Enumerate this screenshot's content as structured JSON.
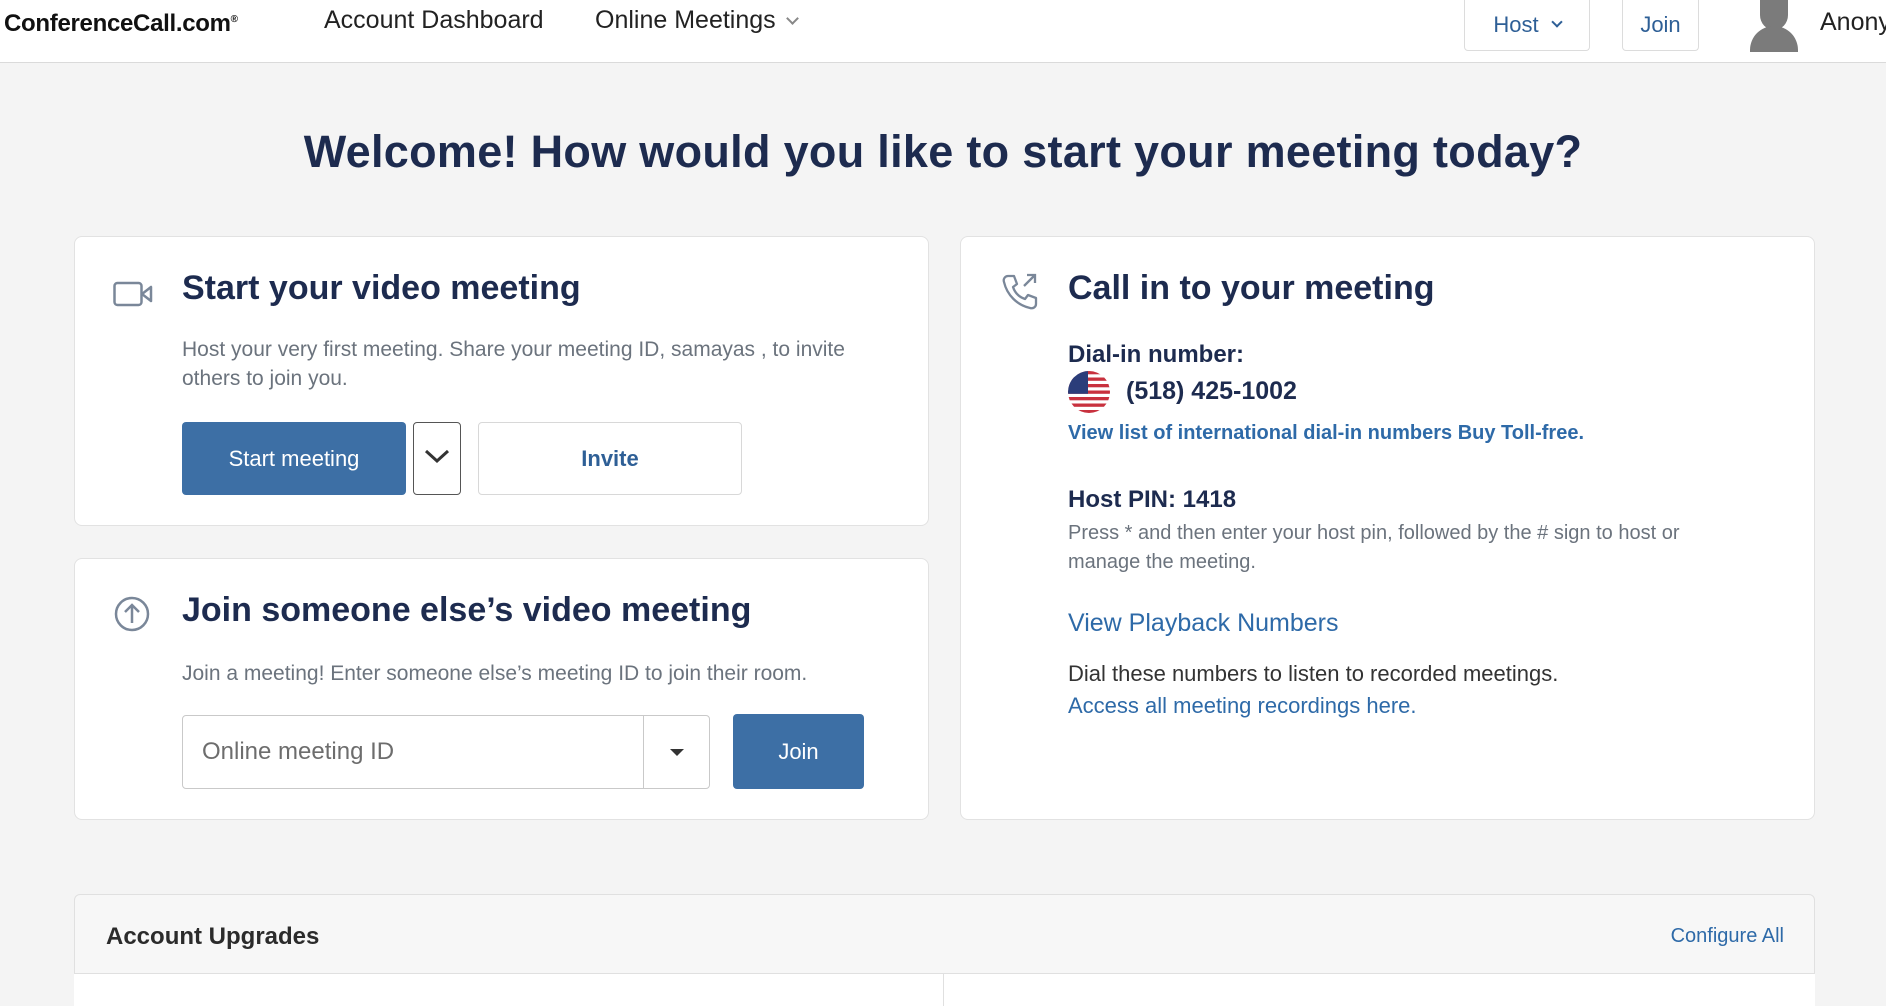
{
  "header": {
    "logo": "ConferenceCall.com",
    "logo_mark": "®",
    "nav": {
      "dashboard": "Account Dashboard",
      "online_meetings": "Online Meetings"
    },
    "host_label": "Host",
    "join_label": "Join",
    "user_name": "Anony"
  },
  "welcome_title": "Welcome! How would you like to start your meeting today?",
  "start_card": {
    "title": "Start your video meeting",
    "description": "Host your very first meeting. Share your meeting ID, samayas , to invite others to join you.",
    "start_label": "Start meeting",
    "invite_label": "Invite"
  },
  "join_card": {
    "title": "Join someone else’s video meeting",
    "description": "Join a meeting! Enter someone else’s meeting ID to join their room.",
    "input_placeholder": "Online meeting ID",
    "join_label": "Join"
  },
  "call_card": {
    "title": "Call in to your meeting",
    "dial_in_label": "Dial-in number:",
    "phone_number": "(518) 425-1002",
    "intl_link": "View list of international dial-in numbers",
    "tollfree_link": "Buy Toll-free.",
    "host_pin_label": "Host PIN: 1418",
    "host_pin_help": "Press * and then enter your host pin, followed by the # sign to host or manage the meeting.",
    "playback_link": "View Playback Numbers",
    "playback_text": "Dial these numbers to listen to recorded meetings.",
    "recordings_link": "Access all meeting recordings here."
  },
  "upgrades": {
    "title": "Account Upgrades",
    "configure_label": "Configure All"
  },
  "colors": {
    "primary": "#3d6fa5",
    "link": "#2e6aa8",
    "heading": "#1d2b4f",
    "background": "#f4f4f4"
  },
  "icons": {
    "video": "video-camera-icon",
    "upload": "arrow-up-circle-icon",
    "phone": "phone-outgoing-icon",
    "flag": "us-flag-icon",
    "avatar": "user-avatar-icon"
  }
}
